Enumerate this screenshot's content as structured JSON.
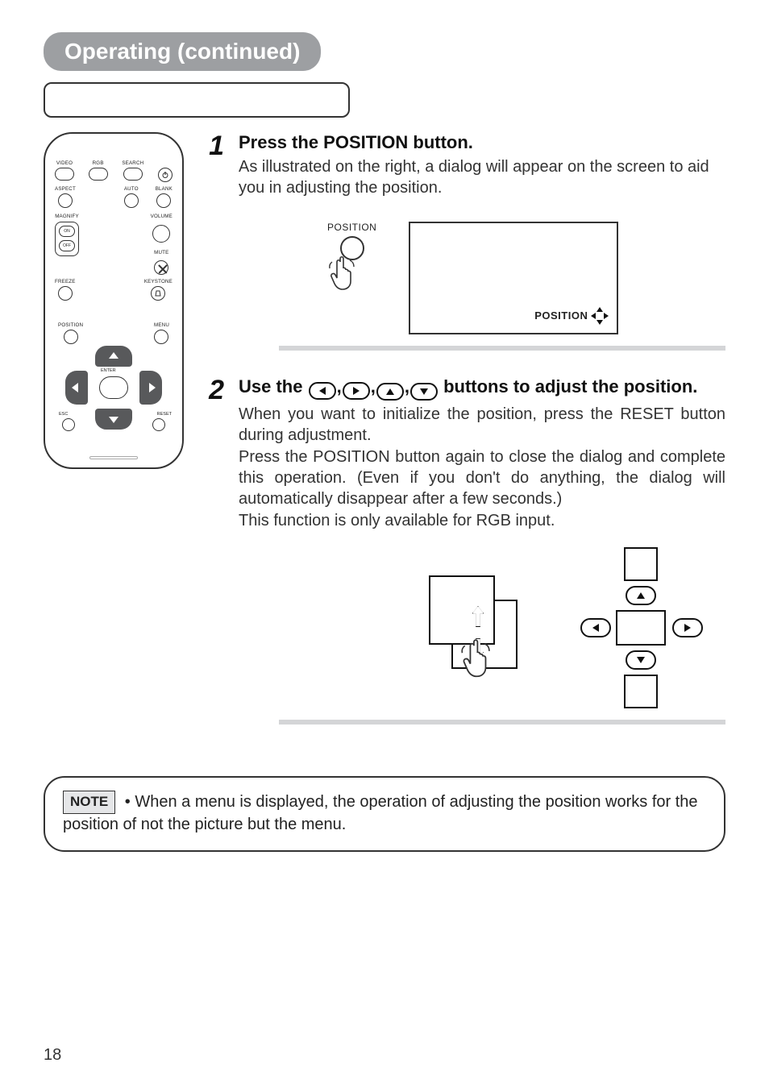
{
  "section_title": "Operating (continued)",
  "remote": {
    "row1": [
      "VIDEO",
      "RGB",
      "SEARCH"
    ],
    "row2": [
      "ASPECT",
      "AUTO",
      "BLANK"
    ],
    "magnify_label": "MAGNIFY",
    "magnify_on": "ON",
    "magnify_off": "OFF",
    "volume_label": "VOLUME",
    "mute_label": "MUTE",
    "freeze_label": "FREEZE",
    "keystone_label": "KEYSTONE",
    "position_label": "POSITION",
    "menu_label": "MENU",
    "enter_label": "ENTER",
    "esc_label": "ESC",
    "reset_label": "RESET"
  },
  "step1": {
    "num": "1",
    "title": "Press the POSITION button.",
    "text": "As illustrated on the right, a dialog will appear on the screen to aid you in adjusting the position.",
    "fig_label": "POSITION",
    "osd_label": "POSITION"
  },
  "step2": {
    "num": "2",
    "title_pre": "Use the ",
    "title_post": " buttons to adjust the position.",
    "text1": "When you want to initialize the position, press the RESET button during adjustment.",
    "text2": "Press the POSITION button again to close the dialog and complete this operation.  (Even if you don't do anything, the dialog will automatically disappear after a few seconds.)",
    "text3": "This function is only available for RGB input."
  },
  "note": {
    "label": "NOTE",
    "text": "• When a menu is displayed, the operation of adjusting the position works for the position of not the picture but the menu."
  },
  "page_number": "18"
}
